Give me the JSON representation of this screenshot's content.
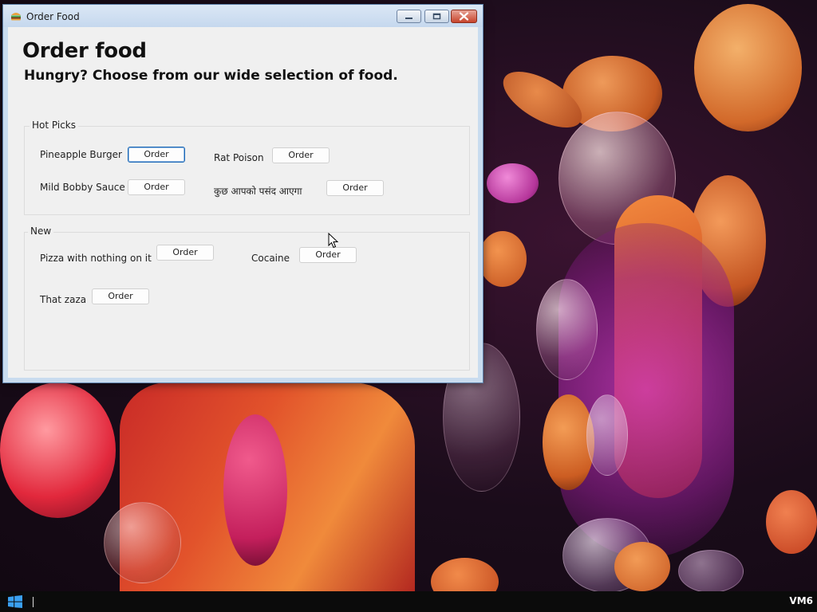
{
  "window": {
    "title": "Order Food"
  },
  "page": {
    "heading": "Order food",
    "subheading": "Hungry? Choose from our wide selection of food."
  },
  "hot_picks": {
    "legend": "Hot Picks",
    "items": [
      {
        "label": "Pineapple Burger",
        "button": "Order"
      },
      {
        "label": "Rat Poison",
        "button": "Order"
      },
      {
        "label": "Mild Bobby Sauce",
        "button": "Order"
      },
      {
        "label": "कुछ आपको पसंद आएगा",
        "button": "Order"
      }
    ]
  },
  "new": {
    "legend": "New",
    "items": [
      {
        "label": "Pizza with nothing on it",
        "button": "Order"
      },
      {
        "label": "Cocaine",
        "button": "Order"
      },
      {
        "label": "That zaza",
        "button": "Order"
      }
    ]
  },
  "taskbar": {
    "vm_label": "VM6"
  },
  "icons": {
    "app": "burger-icon",
    "start": "windows-logo-icon",
    "cursor": "mouse-pointer-icon"
  },
  "colors": {
    "focus_border": "#1a67b6",
    "close_button": "#c7442c",
    "window_frame": "#c9dcef"
  }
}
